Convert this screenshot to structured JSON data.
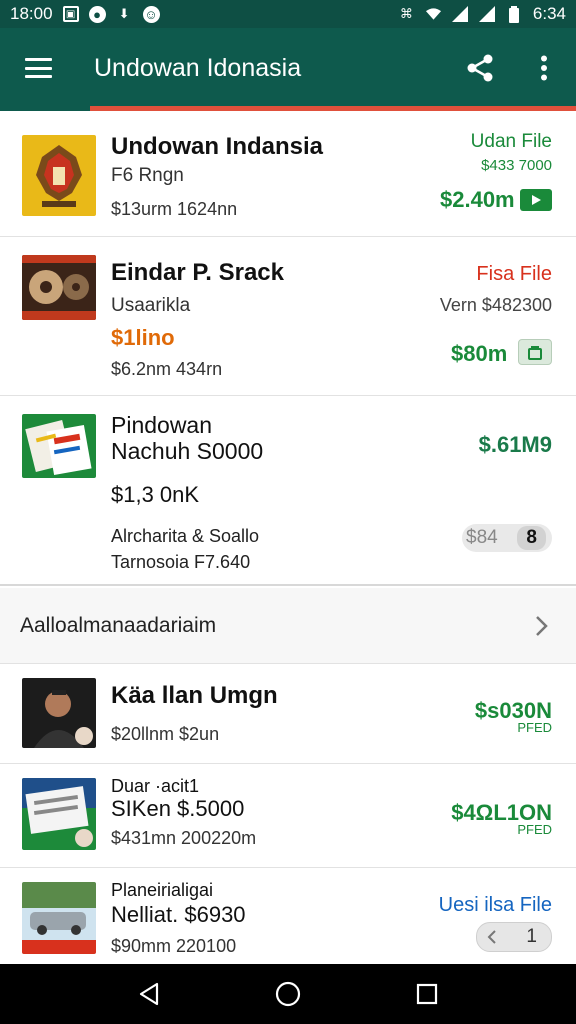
{
  "status": {
    "time": "18:00",
    "clock_right": "6:34"
  },
  "app_bar": {
    "title": "Undowan Idonasia"
  },
  "items": [
    {
      "title": "Undowan Indansia",
      "sub1": "F6 Rngn",
      "sub2": "$13urm 1624nn",
      "right_top": "Udan File",
      "right_mid": "$433 7000",
      "right_price": "$2.40m"
    },
    {
      "title": "Eindar P. Srack",
      "sub1": "Usaarikla",
      "sub_accent": "$1lino",
      "sub2": "$6.2nm 434rn",
      "right_top": "Fisa File",
      "right_mid": "Vern $482300",
      "right_price": "$80m"
    },
    {
      "title_line1": "Pindowan",
      "title_line2": "Nachuh S0000",
      "price": "$1,3 0nK",
      "sub1": "Alrcharita & Soallo",
      "sub2": "Tarnosoia F7.640",
      "right_price": "$.61M9",
      "pill_left": "$84",
      "pill_right": "8"
    }
  ],
  "section_header": {
    "label": "Aalloalmanaadariaim"
  },
  "items2": [
    {
      "title": "Käa llan Umgn",
      "sub": "$20llnm $2un",
      "right_price": "$s030N",
      "right_tag": "PFED"
    },
    {
      "title_line1": "Duar ·acit1",
      "title_line2": "SIKen $.5000",
      "sub": "$431mn 200220m",
      "right_price": "$4ΩL1ON",
      "right_tag": "PFED"
    },
    {
      "title_line1": "Planeirialigai",
      "title_line2": "Nelliat. $6930",
      "sub": "$90mm 220100",
      "right_top": "Uesi ilsa File",
      "pill_num": "1"
    }
  ]
}
